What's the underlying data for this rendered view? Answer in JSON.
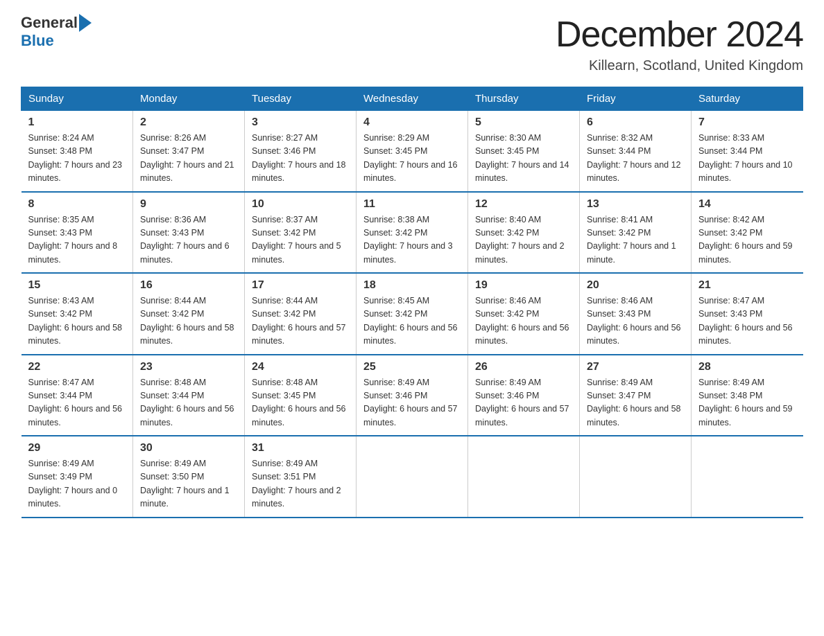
{
  "header": {
    "logo_general": "General",
    "logo_blue": "Blue",
    "month_title": "December 2024",
    "location": "Killearn, Scotland, United Kingdom"
  },
  "days_of_week": [
    "Sunday",
    "Monday",
    "Tuesday",
    "Wednesday",
    "Thursday",
    "Friday",
    "Saturday"
  ],
  "weeks": [
    [
      {
        "day": "1",
        "sunrise": "8:24 AM",
        "sunset": "3:48 PM",
        "daylight": "7 hours and 23 minutes."
      },
      {
        "day": "2",
        "sunrise": "8:26 AM",
        "sunset": "3:47 PM",
        "daylight": "7 hours and 21 minutes."
      },
      {
        "day": "3",
        "sunrise": "8:27 AM",
        "sunset": "3:46 PM",
        "daylight": "7 hours and 18 minutes."
      },
      {
        "day": "4",
        "sunrise": "8:29 AM",
        "sunset": "3:45 PM",
        "daylight": "7 hours and 16 minutes."
      },
      {
        "day": "5",
        "sunrise": "8:30 AM",
        "sunset": "3:45 PM",
        "daylight": "7 hours and 14 minutes."
      },
      {
        "day": "6",
        "sunrise": "8:32 AM",
        "sunset": "3:44 PM",
        "daylight": "7 hours and 12 minutes."
      },
      {
        "day": "7",
        "sunrise": "8:33 AM",
        "sunset": "3:44 PM",
        "daylight": "7 hours and 10 minutes."
      }
    ],
    [
      {
        "day": "8",
        "sunrise": "8:35 AM",
        "sunset": "3:43 PM",
        "daylight": "7 hours and 8 minutes."
      },
      {
        "day": "9",
        "sunrise": "8:36 AM",
        "sunset": "3:43 PM",
        "daylight": "7 hours and 6 minutes."
      },
      {
        "day": "10",
        "sunrise": "8:37 AM",
        "sunset": "3:42 PM",
        "daylight": "7 hours and 5 minutes."
      },
      {
        "day": "11",
        "sunrise": "8:38 AM",
        "sunset": "3:42 PM",
        "daylight": "7 hours and 3 minutes."
      },
      {
        "day": "12",
        "sunrise": "8:40 AM",
        "sunset": "3:42 PM",
        "daylight": "7 hours and 2 minutes."
      },
      {
        "day": "13",
        "sunrise": "8:41 AM",
        "sunset": "3:42 PM",
        "daylight": "7 hours and 1 minute."
      },
      {
        "day": "14",
        "sunrise": "8:42 AM",
        "sunset": "3:42 PM",
        "daylight": "6 hours and 59 minutes."
      }
    ],
    [
      {
        "day": "15",
        "sunrise": "8:43 AM",
        "sunset": "3:42 PM",
        "daylight": "6 hours and 58 minutes."
      },
      {
        "day": "16",
        "sunrise": "8:44 AM",
        "sunset": "3:42 PM",
        "daylight": "6 hours and 58 minutes."
      },
      {
        "day": "17",
        "sunrise": "8:44 AM",
        "sunset": "3:42 PM",
        "daylight": "6 hours and 57 minutes."
      },
      {
        "day": "18",
        "sunrise": "8:45 AM",
        "sunset": "3:42 PM",
        "daylight": "6 hours and 56 minutes."
      },
      {
        "day": "19",
        "sunrise": "8:46 AM",
        "sunset": "3:42 PM",
        "daylight": "6 hours and 56 minutes."
      },
      {
        "day": "20",
        "sunrise": "8:46 AM",
        "sunset": "3:43 PM",
        "daylight": "6 hours and 56 minutes."
      },
      {
        "day": "21",
        "sunrise": "8:47 AM",
        "sunset": "3:43 PM",
        "daylight": "6 hours and 56 minutes."
      }
    ],
    [
      {
        "day": "22",
        "sunrise": "8:47 AM",
        "sunset": "3:44 PM",
        "daylight": "6 hours and 56 minutes."
      },
      {
        "day": "23",
        "sunrise": "8:48 AM",
        "sunset": "3:44 PM",
        "daylight": "6 hours and 56 minutes."
      },
      {
        "day": "24",
        "sunrise": "8:48 AM",
        "sunset": "3:45 PM",
        "daylight": "6 hours and 56 minutes."
      },
      {
        "day": "25",
        "sunrise": "8:49 AM",
        "sunset": "3:46 PM",
        "daylight": "6 hours and 57 minutes."
      },
      {
        "day": "26",
        "sunrise": "8:49 AM",
        "sunset": "3:46 PM",
        "daylight": "6 hours and 57 minutes."
      },
      {
        "day": "27",
        "sunrise": "8:49 AM",
        "sunset": "3:47 PM",
        "daylight": "6 hours and 58 minutes."
      },
      {
        "day": "28",
        "sunrise": "8:49 AM",
        "sunset": "3:48 PM",
        "daylight": "6 hours and 59 minutes."
      }
    ],
    [
      {
        "day": "29",
        "sunrise": "8:49 AM",
        "sunset": "3:49 PM",
        "daylight": "7 hours and 0 minutes."
      },
      {
        "day": "30",
        "sunrise": "8:49 AM",
        "sunset": "3:50 PM",
        "daylight": "7 hours and 1 minute."
      },
      {
        "day": "31",
        "sunrise": "8:49 AM",
        "sunset": "3:51 PM",
        "daylight": "7 hours and 2 minutes."
      },
      null,
      null,
      null,
      null
    ]
  ]
}
